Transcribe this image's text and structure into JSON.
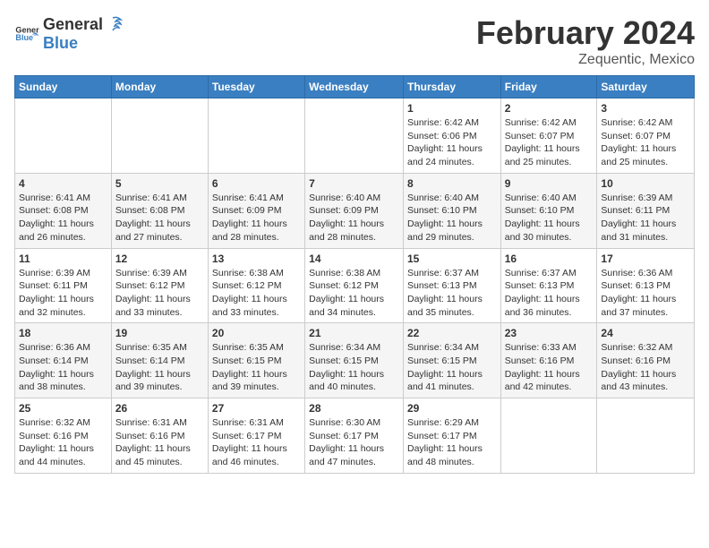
{
  "header": {
    "logo_general": "General",
    "logo_blue": "Blue",
    "month_title": "February 2024",
    "location": "Zequentic, Mexico"
  },
  "calendar": {
    "days_of_week": [
      "Sunday",
      "Monday",
      "Tuesday",
      "Wednesday",
      "Thursday",
      "Friday",
      "Saturday"
    ],
    "weeks": [
      [
        {
          "day": "",
          "info": ""
        },
        {
          "day": "",
          "info": ""
        },
        {
          "day": "",
          "info": ""
        },
        {
          "day": "",
          "info": ""
        },
        {
          "day": "1",
          "info": "Sunrise: 6:42 AM\nSunset: 6:06 PM\nDaylight: 11 hours and 24 minutes."
        },
        {
          "day": "2",
          "info": "Sunrise: 6:42 AM\nSunset: 6:07 PM\nDaylight: 11 hours and 25 minutes."
        },
        {
          "day": "3",
          "info": "Sunrise: 6:42 AM\nSunset: 6:07 PM\nDaylight: 11 hours and 25 minutes."
        }
      ],
      [
        {
          "day": "4",
          "info": "Sunrise: 6:41 AM\nSunset: 6:08 PM\nDaylight: 11 hours and 26 minutes."
        },
        {
          "day": "5",
          "info": "Sunrise: 6:41 AM\nSunset: 6:08 PM\nDaylight: 11 hours and 27 minutes."
        },
        {
          "day": "6",
          "info": "Sunrise: 6:41 AM\nSunset: 6:09 PM\nDaylight: 11 hours and 28 minutes."
        },
        {
          "day": "7",
          "info": "Sunrise: 6:40 AM\nSunset: 6:09 PM\nDaylight: 11 hours and 28 minutes."
        },
        {
          "day": "8",
          "info": "Sunrise: 6:40 AM\nSunset: 6:10 PM\nDaylight: 11 hours and 29 minutes."
        },
        {
          "day": "9",
          "info": "Sunrise: 6:40 AM\nSunset: 6:10 PM\nDaylight: 11 hours and 30 minutes."
        },
        {
          "day": "10",
          "info": "Sunrise: 6:39 AM\nSunset: 6:11 PM\nDaylight: 11 hours and 31 minutes."
        }
      ],
      [
        {
          "day": "11",
          "info": "Sunrise: 6:39 AM\nSunset: 6:11 PM\nDaylight: 11 hours and 32 minutes."
        },
        {
          "day": "12",
          "info": "Sunrise: 6:39 AM\nSunset: 6:12 PM\nDaylight: 11 hours and 33 minutes."
        },
        {
          "day": "13",
          "info": "Sunrise: 6:38 AM\nSunset: 6:12 PM\nDaylight: 11 hours and 33 minutes."
        },
        {
          "day": "14",
          "info": "Sunrise: 6:38 AM\nSunset: 6:12 PM\nDaylight: 11 hours and 34 minutes."
        },
        {
          "day": "15",
          "info": "Sunrise: 6:37 AM\nSunset: 6:13 PM\nDaylight: 11 hours and 35 minutes."
        },
        {
          "day": "16",
          "info": "Sunrise: 6:37 AM\nSunset: 6:13 PM\nDaylight: 11 hours and 36 minutes."
        },
        {
          "day": "17",
          "info": "Sunrise: 6:36 AM\nSunset: 6:13 PM\nDaylight: 11 hours and 37 minutes."
        }
      ],
      [
        {
          "day": "18",
          "info": "Sunrise: 6:36 AM\nSunset: 6:14 PM\nDaylight: 11 hours and 38 minutes."
        },
        {
          "day": "19",
          "info": "Sunrise: 6:35 AM\nSunset: 6:14 PM\nDaylight: 11 hours and 39 minutes."
        },
        {
          "day": "20",
          "info": "Sunrise: 6:35 AM\nSunset: 6:15 PM\nDaylight: 11 hours and 39 minutes."
        },
        {
          "day": "21",
          "info": "Sunrise: 6:34 AM\nSunset: 6:15 PM\nDaylight: 11 hours and 40 minutes."
        },
        {
          "day": "22",
          "info": "Sunrise: 6:34 AM\nSunset: 6:15 PM\nDaylight: 11 hours and 41 minutes."
        },
        {
          "day": "23",
          "info": "Sunrise: 6:33 AM\nSunset: 6:16 PM\nDaylight: 11 hours and 42 minutes."
        },
        {
          "day": "24",
          "info": "Sunrise: 6:32 AM\nSunset: 6:16 PM\nDaylight: 11 hours and 43 minutes."
        }
      ],
      [
        {
          "day": "25",
          "info": "Sunrise: 6:32 AM\nSunset: 6:16 PM\nDaylight: 11 hours and 44 minutes."
        },
        {
          "day": "26",
          "info": "Sunrise: 6:31 AM\nSunset: 6:16 PM\nDaylight: 11 hours and 45 minutes."
        },
        {
          "day": "27",
          "info": "Sunrise: 6:31 AM\nSunset: 6:17 PM\nDaylight: 11 hours and 46 minutes."
        },
        {
          "day": "28",
          "info": "Sunrise: 6:30 AM\nSunset: 6:17 PM\nDaylight: 11 hours and 47 minutes."
        },
        {
          "day": "29",
          "info": "Sunrise: 6:29 AM\nSunset: 6:17 PM\nDaylight: 11 hours and 48 minutes."
        },
        {
          "day": "",
          "info": ""
        },
        {
          "day": "",
          "info": ""
        }
      ]
    ]
  }
}
